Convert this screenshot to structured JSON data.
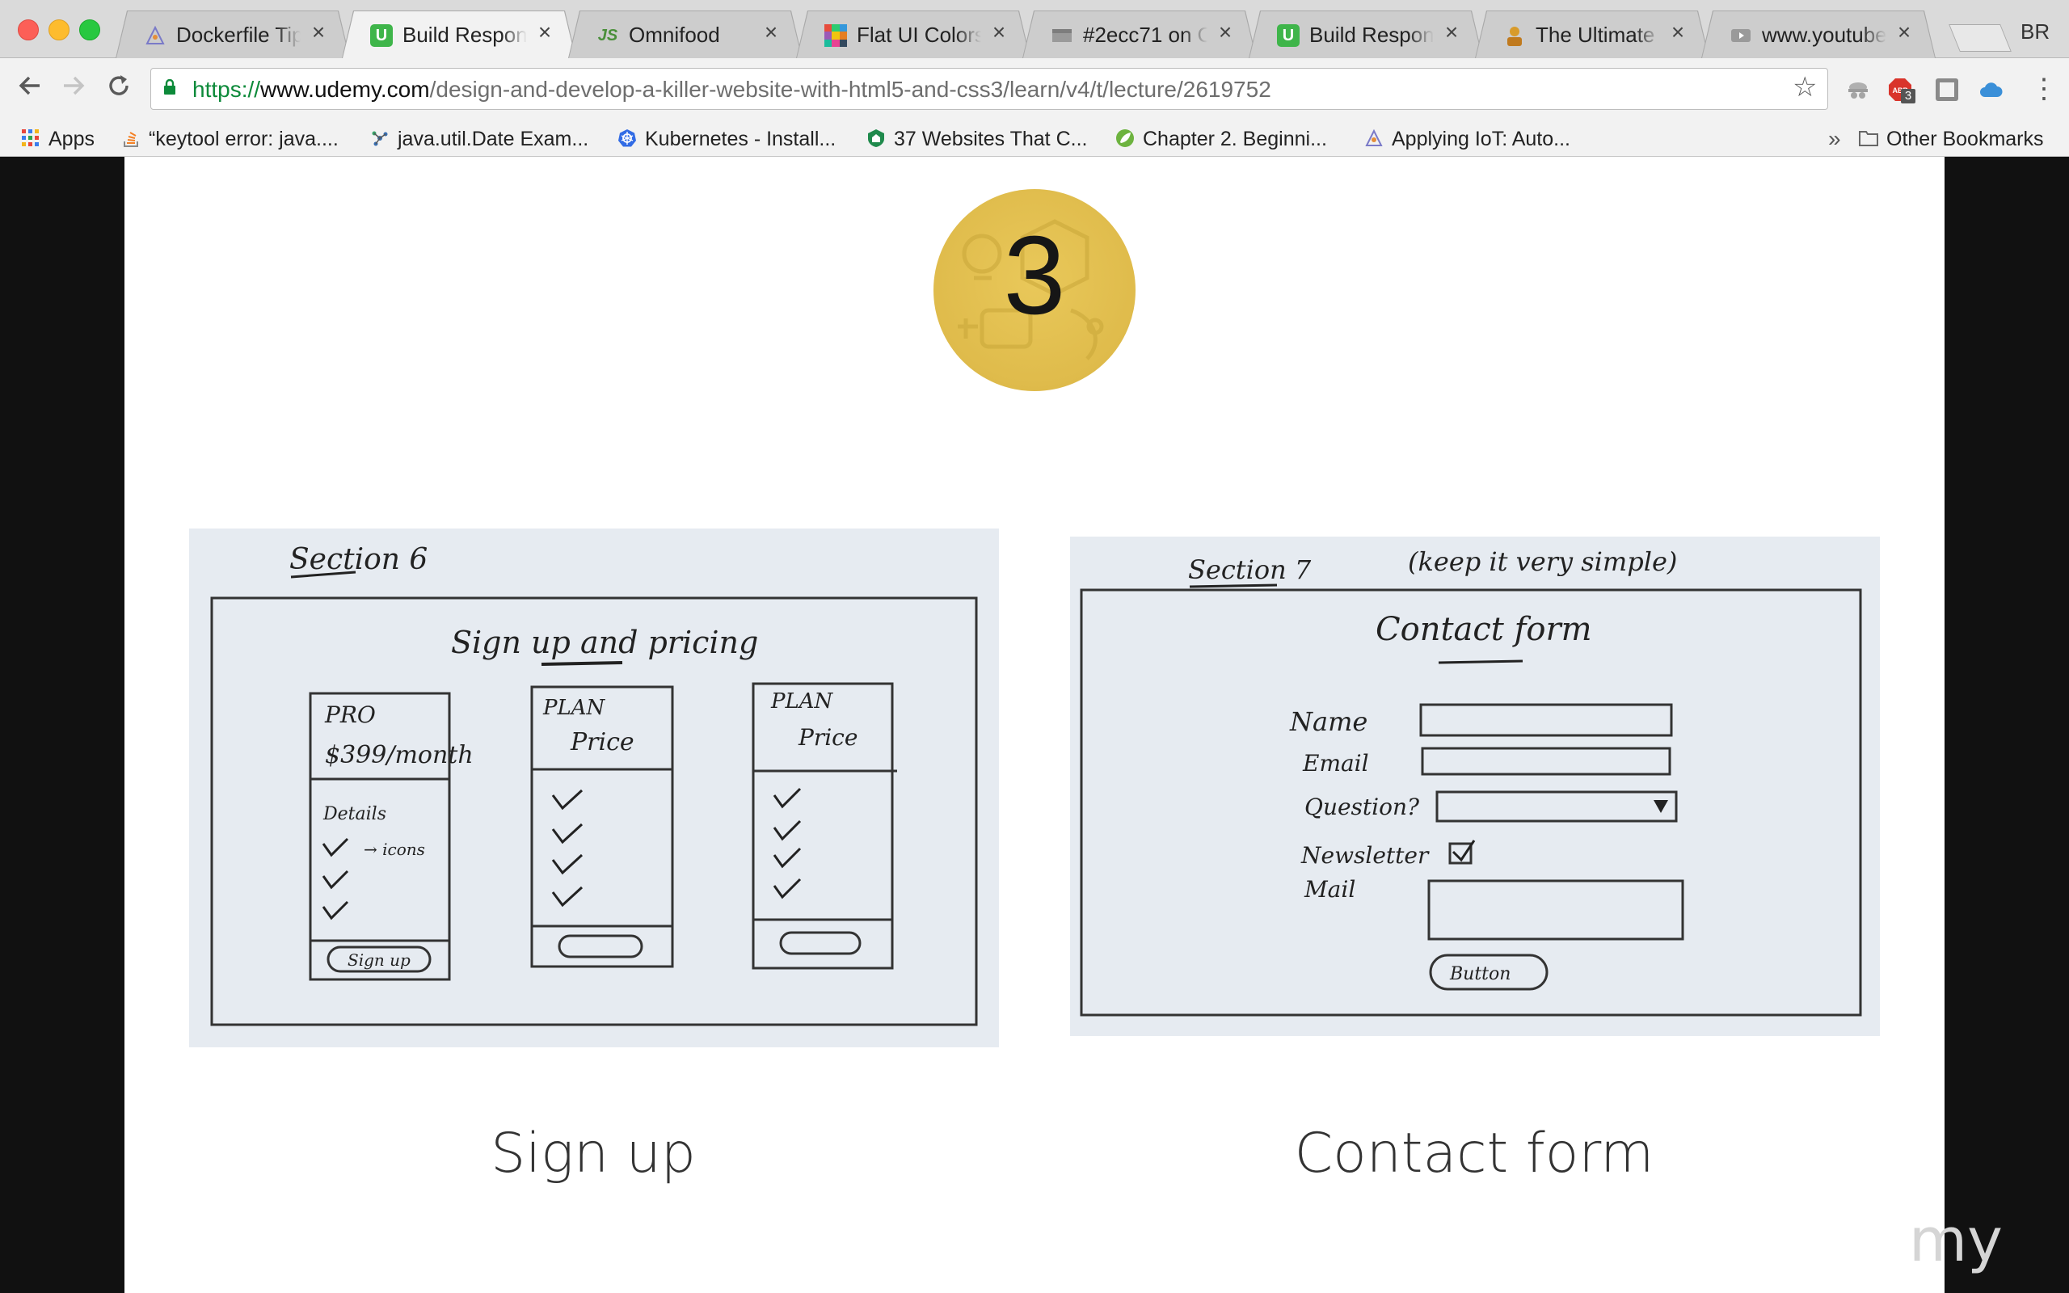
{
  "tabs": [
    {
      "title": "Dockerfile Tips",
      "favicon": "pen-icon",
      "active": false
    },
    {
      "title": "Build Responsive",
      "favicon": "udemy-icon",
      "active": true
    },
    {
      "title": "Omnifood",
      "favicon": "js-icon",
      "active": false
    },
    {
      "title": "Flat UI Colors -",
      "favicon": "color-grid-icon",
      "active": false
    },
    {
      "title": "#2ecc71 on Ot",
      "favicon": "grey-page-icon",
      "active": false
    },
    {
      "title": "Build Responsive",
      "favicon": "udemy-icon",
      "active": false
    },
    {
      "title": "The Ultimate P",
      "favicon": "person-icon",
      "active": false
    },
    {
      "title": "www.youtube.c",
      "favicon": "youtube-icon",
      "active": false
    }
  ],
  "profile": "BR",
  "address_bar": {
    "scheme": "https://",
    "host": "www.udemy.com",
    "path": "/design-and-develop-a-killer-website-with-html5-and-css3/learn/v4/t/lecture/2619752"
  },
  "extensions": {
    "adblock_count": "3"
  },
  "bookmarks": [
    {
      "label": "Apps",
      "icon": "apps-grid-icon"
    },
    {
      "label": "“keytool error: java....",
      "icon": "stackoverflow-icon"
    },
    {
      "label": "java.util.Date Exam...",
      "icon": "molecule-icon"
    },
    {
      "label": "Kubernetes - Install...",
      "icon": "kubernetes-icon"
    },
    {
      "label": "37 Websites That C...",
      "icon": "shield-icon"
    },
    {
      "label": "Chapter 2. Beginni...",
      "icon": "spring-icon"
    },
    {
      "label": "Applying IoT: Auto...",
      "icon": "pen-icon"
    }
  ],
  "bookmarks_overflow": "»",
  "other_bookmarks": "Other Bookmarks",
  "slide": {
    "step_number": "3",
    "left": {
      "caption": "Sign up",
      "sketch_heading": "Section 6",
      "sketch_title": "Sign up and pricing",
      "plans": [
        {
          "name": "PRO",
          "price": "$399/month",
          "features": [
            "Details",
            "→ icons"
          ],
          "button": "Sign up"
        },
        {
          "name": "PLAN",
          "price": "Price",
          "features": [],
          "button": ""
        },
        {
          "name": "PLAN",
          "price": "Price",
          "features": [],
          "button": ""
        }
      ]
    },
    "right": {
      "caption": "Contact form",
      "sketch_heading": "Section 7",
      "sketch_note": "(keep it very simple)",
      "sketch_title": "Contact form",
      "fields": [
        "Name",
        "Email",
        "Question?",
        "Newsletter",
        "Mail"
      ],
      "button": "Button"
    },
    "watermark": "my"
  }
}
